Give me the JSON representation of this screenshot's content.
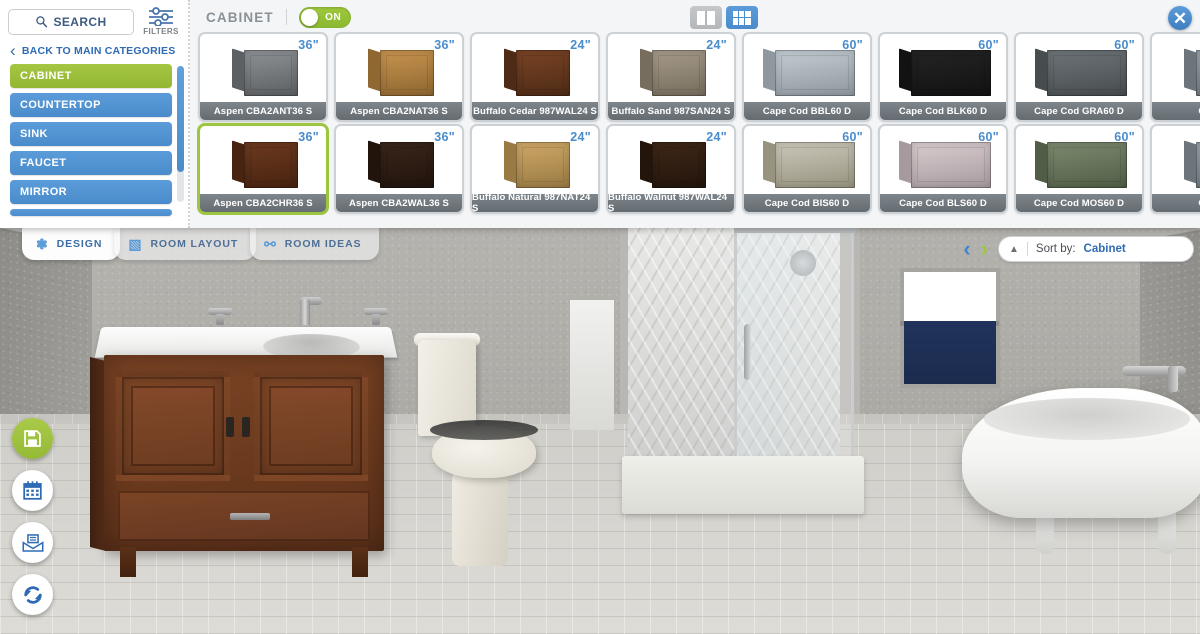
{
  "sidebar": {
    "search_label": "SEARCH",
    "search_icon": "search-icon",
    "filters_label": "FILTERS",
    "filters_icon": "sliders-icon",
    "back_label": "BACK TO MAIN CATEGORIES",
    "back_icon": "chevron-left-icon",
    "categories": [
      {
        "label": "CABINET",
        "active": true
      },
      {
        "label": "COUNTERTOP",
        "active": false
      },
      {
        "label": "SINK",
        "active": false
      },
      {
        "label": "FAUCET",
        "active": false
      },
      {
        "label": "MIRROR",
        "active": false
      }
    ]
  },
  "panel": {
    "title": "CABINET",
    "toggle_state": "ON",
    "view_single_icon": "single-column-view-icon",
    "view_grid_icon": "grid-view-icon",
    "close_icon": "close-icon",
    "close_glyph": "✕"
  },
  "products": {
    "row1": [
      {
        "name": "Aspen CBA2ANT36 S",
        "size": "36\"",
        "front": "#8e9296",
        "side": "#5c6063",
        "selected": false
      },
      {
        "name": "Aspen CBA2NAT36 S",
        "size": "36\"",
        "front": "#c9944f",
        "side": "#8e6731",
        "selected": false
      },
      {
        "name": "Buffalo Cedar 987WAL24 S",
        "size": "24\"",
        "front": "#7a4425",
        "side": "#4e2b16",
        "selected": false
      },
      {
        "name": "Buffalo Sand 987SAN24 S",
        "size": "24\"",
        "front": "#a79c8a",
        "side": "#766d5e",
        "selected": false
      },
      {
        "name": "Cape Cod BBL60 D",
        "size": "60\"",
        "front": "#c3cdd3",
        "side": "#8e989e",
        "selected": false
      },
      {
        "name": "Cape Cod BLK60 D",
        "size": "60\"",
        "front": "#242424",
        "side": "#121212",
        "selected": false
      },
      {
        "name": "Cape Cod GRA60 D",
        "size": "60\"",
        "front": "#6e7578",
        "side": "#474c4f",
        "selected": false
      },
      {
        "name": "Cape C",
        "size": "",
        "front": "#9aa4ab",
        "side": "#6c757b",
        "selected": false
      }
    ],
    "row2": [
      {
        "name": "Aspen CBA2CHR36 S",
        "size": "36\"",
        "front": "#6d3a1f",
        "side": "#472310",
        "selected": true
      },
      {
        "name": "Aspen CBA2WAL36 S",
        "size": "36\"",
        "front": "#3a251a",
        "side": "#21140d",
        "selected": false
      },
      {
        "name": "Buffalo Natural 987NAT24 S",
        "size": "24\"",
        "front": "#cfa868",
        "side": "#997a43",
        "selected": false
      },
      {
        "name": "Buffalo Walnut 987WAL24 S",
        "size": "24\"",
        "front": "#3f2717",
        "side": "#23150c",
        "selected": false
      },
      {
        "name": "Cape Cod BIS60 D",
        "size": "60\"",
        "front": "#ccc8bb",
        "side": "#97937f",
        "selected": false
      },
      {
        "name": "Cape Cod BLS60 D",
        "size": "60\"",
        "front": "#d9cdd0",
        "side": "#a69a9e",
        "selected": false
      },
      {
        "name": "Cape Cod MOS60 D",
        "size": "60\"",
        "front": "#7d8a6f",
        "side": "#515d46",
        "selected": false
      },
      {
        "name": "Cape C",
        "size": "",
        "front": "#9aa4ab",
        "side": "#6c757b",
        "selected": false
      }
    ]
  },
  "tabs": [
    {
      "label": "DESIGN",
      "icon": "palette-icon",
      "glyph": "❃",
      "active": true
    },
    {
      "label": "ROOM LAYOUT",
      "icon": "floorplan-icon",
      "glyph": "▧",
      "active": false
    },
    {
      "label": "ROOM IDEAS",
      "icon": "lightbulb-icon",
      "glyph": "⚯",
      "active": false
    }
  ],
  "sort": {
    "prev_icon": "chevron-left-icon",
    "prev_glyph": "‹",
    "next_icon": "chevron-right-icon",
    "next_glyph": "›",
    "caret_icon": "chevron-up-icon",
    "caret_glyph": "▲",
    "label": "Sort by:",
    "value": "Cabinet"
  },
  "actions": [
    {
      "icon": "save-icon",
      "accent": true
    },
    {
      "icon": "calendar-icon",
      "accent": false
    },
    {
      "icon": "email-icon",
      "accent": false
    },
    {
      "icon": "refresh-icon",
      "accent": false
    }
  ],
  "colors": {
    "accent_green": "#9dc63f",
    "accent_blue": "#4a8ccb",
    "panel_bg": "#f4f5f6",
    "label_bg": "#6f777d"
  }
}
